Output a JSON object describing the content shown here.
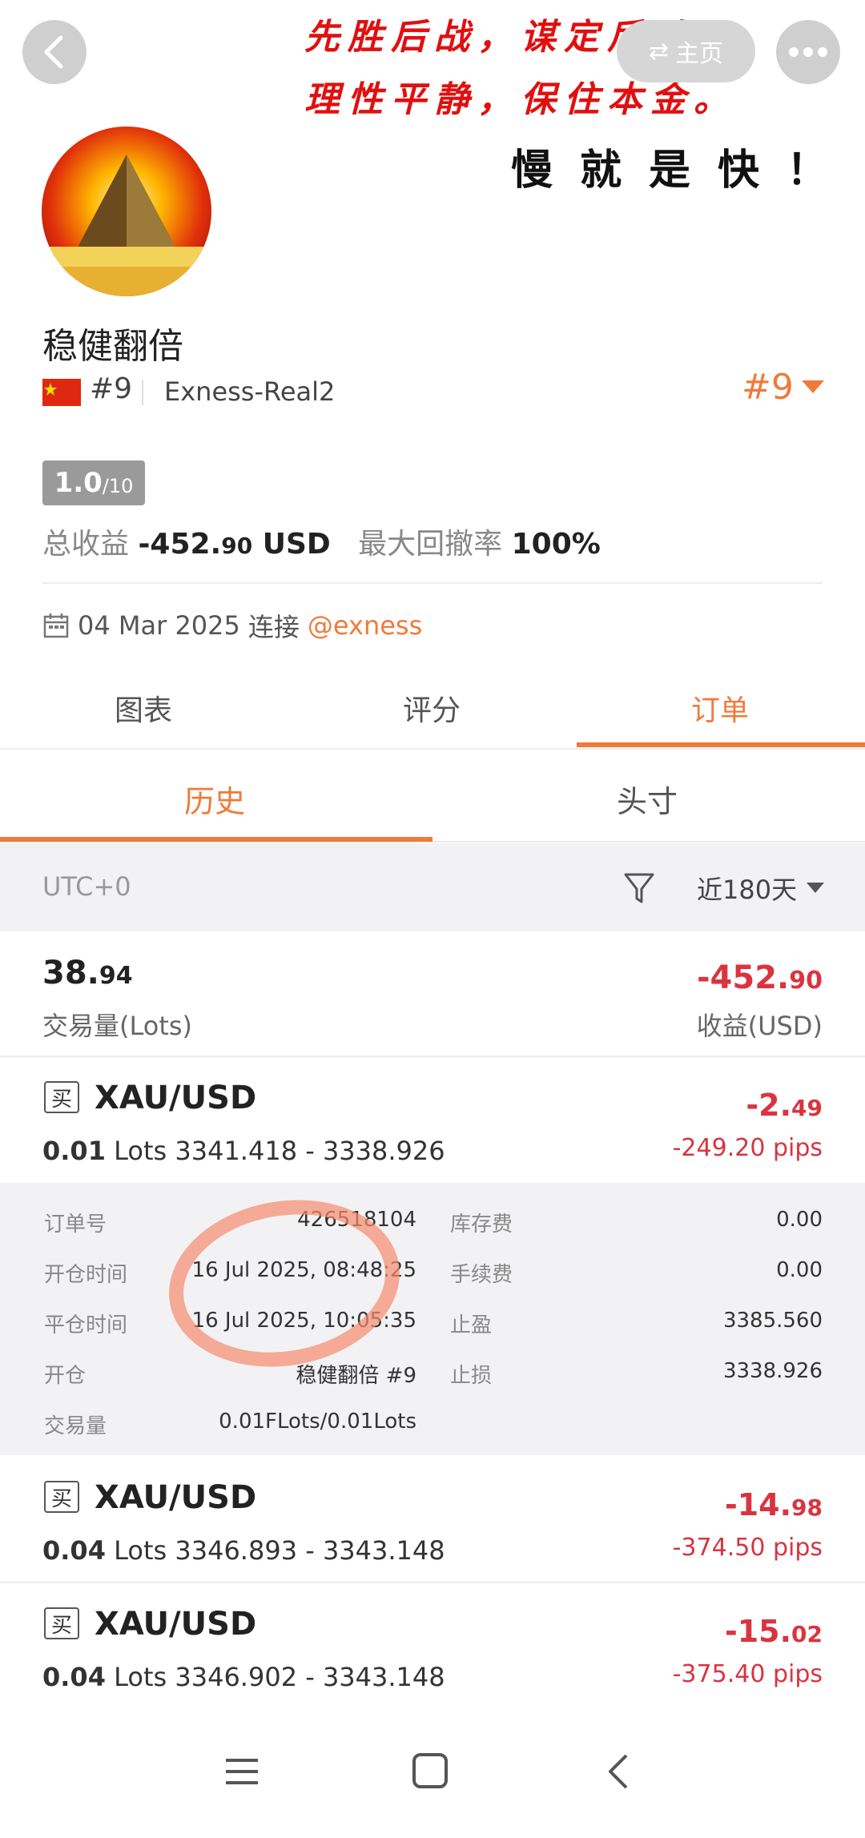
{
  "header": {
    "home_label": "主页",
    "calligraphy_line1": "先胜后战，谋定后动；",
    "calligraphy_line2": "理性平静，保住本金。",
    "slogan": "慢就是快！"
  },
  "profile": {
    "name": "稳健翻倍",
    "rank_small": "#9",
    "account": "Exness-Real2",
    "rank_big": "#9",
    "score": "1.0",
    "score_max": "/10",
    "total_profit_label": "总收益",
    "total_profit_int": "-452.",
    "total_profit_dec": "90",
    "total_profit_unit": "USD",
    "max_drawdown_label": "最大回撤率",
    "max_drawdown": "100%",
    "connected_date": "04 Mar 2025",
    "connected_label": "连接",
    "broker_link": "@exness"
  },
  "tabs": [
    {
      "label": "图表"
    },
    {
      "label": "评分"
    },
    {
      "label": "订单"
    }
  ],
  "subtabs": [
    {
      "label": "历史"
    },
    {
      "label": "头寸"
    }
  ],
  "filter": {
    "timezone": "UTC+0",
    "range": "近180天"
  },
  "summary": {
    "volume_int": "38.",
    "volume_dec": "94",
    "volume_label": "交易量(Lots)",
    "profit_int": "-452.",
    "profit_dec": "90",
    "profit_label": "收益(USD)"
  },
  "trades": [
    {
      "type": "买",
      "symbol": "XAU/USD",
      "lots": "0.01",
      "lots_unit": "Lots",
      "prices": "3341.418 - 3338.926",
      "profit_int": "-2.",
      "profit_dec": "49",
      "pips": "-249.20 pips"
    },
    {
      "type": "买",
      "symbol": "XAU/USD",
      "lots": "0.04",
      "lots_unit": "Lots",
      "prices": "3346.893 - 3343.148",
      "profit_int": "-14.",
      "profit_dec": "98",
      "pips": "-374.50 pips"
    },
    {
      "type": "买",
      "symbol": "XAU/USD",
      "lots": "0.04",
      "lots_unit": "Lots",
      "prices": "3346.902 - 3343.148",
      "profit_int": "-15.",
      "profit_dec": "02",
      "pips": "-375.40 pips"
    }
  ],
  "detail": {
    "order_no_label": "订单号",
    "order_no": "426518104",
    "open_time_label": "开仓时间",
    "open_time": "16 Jul 2025, 08:48:25",
    "close_time_label": "平仓时间",
    "close_time": "16 Jul 2025, 10:05:35",
    "open_by_label": "开仓",
    "open_by": "稳健翻倍  #9",
    "volume_label": "交易量",
    "volume": "0.01FLots/0.01Lots",
    "swap_label": "库存费",
    "swap": "0.00",
    "fee_label": "手续费",
    "fee": "0.00",
    "tp_label": "止盈",
    "tp": "3385.560",
    "sl_label": "止损",
    "sl": "3338.926"
  },
  "colors": {
    "accent": "#f07a3a",
    "loss": "#d9343f",
    "calligraphy": "#e01010"
  }
}
